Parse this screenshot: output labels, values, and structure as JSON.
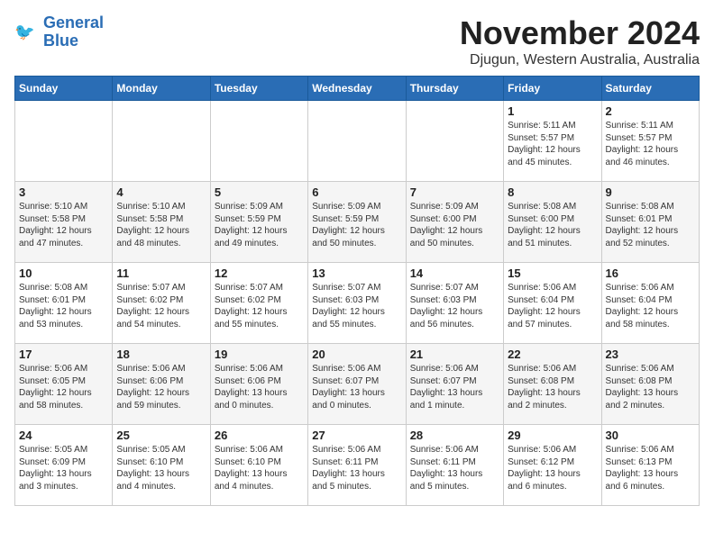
{
  "logo": {
    "line1": "General",
    "line2": "Blue"
  },
  "title": "November 2024",
  "location": "Djugun, Western Australia, Australia",
  "days_of_week": [
    "Sunday",
    "Monday",
    "Tuesday",
    "Wednesday",
    "Thursday",
    "Friday",
    "Saturday"
  ],
  "weeks": [
    [
      {
        "day": "",
        "info": ""
      },
      {
        "day": "",
        "info": ""
      },
      {
        "day": "",
        "info": ""
      },
      {
        "day": "",
        "info": ""
      },
      {
        "day": "",
        "info": ""
      },
      {
        "day": "1",
        "info": "Sunrise: 5:11 AM\nSunset: 5:57 PM\nDaylight: 12 hours\nand 45 minutes."
      },
      {
        "day": "2",
        "info": "Sunrise: 5:11 AM\nSunset: 5:57 PM\nDaylight: 12 hours\nand 46 minutes."
      }
    ],
    [
      {
        "day": "3",
        "info": "Sunrise: 5:10 AM\nSunset: 5:58 PM\nDaylight: 12 hours\nand 47 minutes."
      },
      {
        "day": "4",
        "info": "Sunrise: 5:10 AM\nSunset: 5:58 PM\nDaylight: 12 hours\nand 48 minutes."
      },
      {
        "day": "5",
        "info": "Sunrise: 5:09 AM\nSunset: 5:59 PM\nDaylight: 12 hours\nand 49 minutes."
      },
      {
        "day": "6",
        "info": "Sunrise: 5:09 AM\nSunset: 5:59 PM\nDaylight: 12 hours\nand 50 minutes."
      },
      {
        "day": "7",
        "info": "Sunrise: 5:09 AM\nSunset: 6:00 PM\nDaylight: 12 hours\nand 50 minutes."
      },
      {
        "day": "8",
        "info": "Sunrise: 5:08 AM\nSunset: 6:00 PM\nDaylight: 12 hours\nand 51 minutes."
      },
      {
        "day": "9",
        "info": "Sunrise: 5:08 AM\nSunset: 6:01 PM\nDaylight: 12 hours\nand 52 minutes."
      }
    ],
    [
      {
        "day": "10",
        "info": "Sunrise: 5:08 AM\nSunset: 6:01 PM\nDaylight: 12 hours\nand 53 minutes."
      },
      {
        "day": "11",
        "info": "Sunrise: 5:07 AM\nSunset: 6:02 PM\nDaylight: 12 hours\nand 54 minutes."
      },
      {
        "day": "12",
        "info": "Sunrise: 5:07 AM\nSunset: 6:02 PM\nDaylight: 12 hours\nand 55 minutes."
      },
      {
        "day": "13",
        "info": "Sunrise: 5:07 AM\nSunset: 6:03 PM\nDaylight: 12 hours\nand 55 minutes."
      },
      {
        "day": "14",
        "info": "Sunrise: 5:07 AM\nSunset: 6:03 PM\nDaylight: 12 hours\nand 56 minutes."
      },
      {
        "day": "15",
        "info": "Sunrise: 5:06 AM\nSunset: 6:04 PM\nDaylight: 12 hours\nand 57 minutes."
      },
      {
        "day": "16",
        "info": "Sunrise: 5:06 AM\nSunset: 6:04 PM\nDaylight: 12 hours\nand 58 minutes."
      }
    ],
    [
      {
        "day": "17",
        "info": "Sunrise: 5:06 AM\nSunset: 6:05 PM\nDaylight: 12 hours\nand 58 minutes."
      },
      {
        "day": "18",
        "info": "Sunrise: 5:06 AM\nSunset: 6:06 PM\nDaylight: 12 hours\nand 59 minutes."
      },
      {
        "day": "19",
        "info": "Sunrise: 5:06 AM\nSunset: 6:06 PM\nDaylight: 13 hours\nand 0 minutes."
      },
      {
        "day": "20",
        "info": "Sunrise: 5:06 AM\nSunset: 6:07 PM\nDaylight: 13 hours\nand 0 minutes."
      },
      {
        "day": "21",
        "info": "Sunrise: 5:06 AM\nSunset: 6:07 PM\nDaylight: 13 hours\nand 1 minute."
      },
      {
        "day": "22",
        "info": "Sunrise: 5:06 AM\nSunset: 6:08 PM\nDaylight: 13 hours\nand 2 minutes."
      },
      {
        "day": "23",
        "info": "Sunrise: 5:06 AM\nSunset: 6:08 PM\nDaylight: 13 hours\nand 2 minutes."
      }
    ],
    [
      {
        "day": "24",
        "info": "Sunrise: 5:05 AM\nSunset: 6:09 PM\nDaylight: 13 hours\nand 3 minutes."
      },
      {
        "day": "25",
        "info": "Sunrise: 5:05 AM\nSunset: 6:10 PM\nDaylight: 13 hours\nand 4 minutes."
      },
      {
        "day": "26",
        "info": "Sunrise: 5:06 AM\nSunset: 6:10 PM\nDaylight: 13 hours\nand 4 minutes."
      },
      {
        "day": "27",
        "info": "Sunrise: 5:06 AM\nSunset: 6:11 PM\nDaylight: 13 hours\nand 5 minutes."
      },
      {
        "day": "28",
        "info": "Sunrise: 5:06 AM\nSunset: 6:11 PM\nDaylight: 13 hours\nand 5 minutes."
      },
      {
        "day": "29",
        "info": "Sunrise: 5:06 AM\nSunset: 6:12 PM\nDaylight: 13 hours\nand 6 minutes."
      },
      {
        "day": "30",
        "info": "Sunrise: 5:06 AM\nSunset: 6:13 PM\nDaylight: 13 hours\nand 6 minutes."
      }
    ]
  ]
}
